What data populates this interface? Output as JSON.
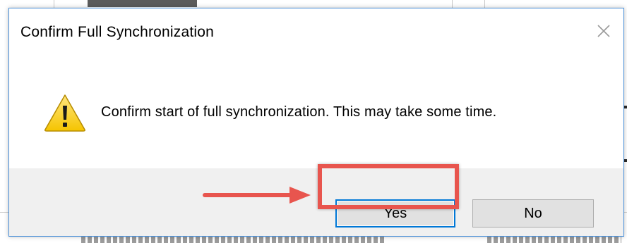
{
  "dialog": {
    "title": "Confirm Full Synchronization",
    "message": "Confirm start of full synchronization. This may take some time.",
    "icon": "warning-icon",
    "close_icon": "close-icon"
  },
  "buttons": {
    "yes_label": "Yes",
    "no_label": "No"
  },
  "annotation": {
    "highlight_color": "#e8554e",
    "arrow_color": "#e8554e"
  },
  "colors": {
    "accent": "#0078d7",
    "footer_bg": "#f0f0f0",
    "dialog_border": "#4a90d9"
  }
}
